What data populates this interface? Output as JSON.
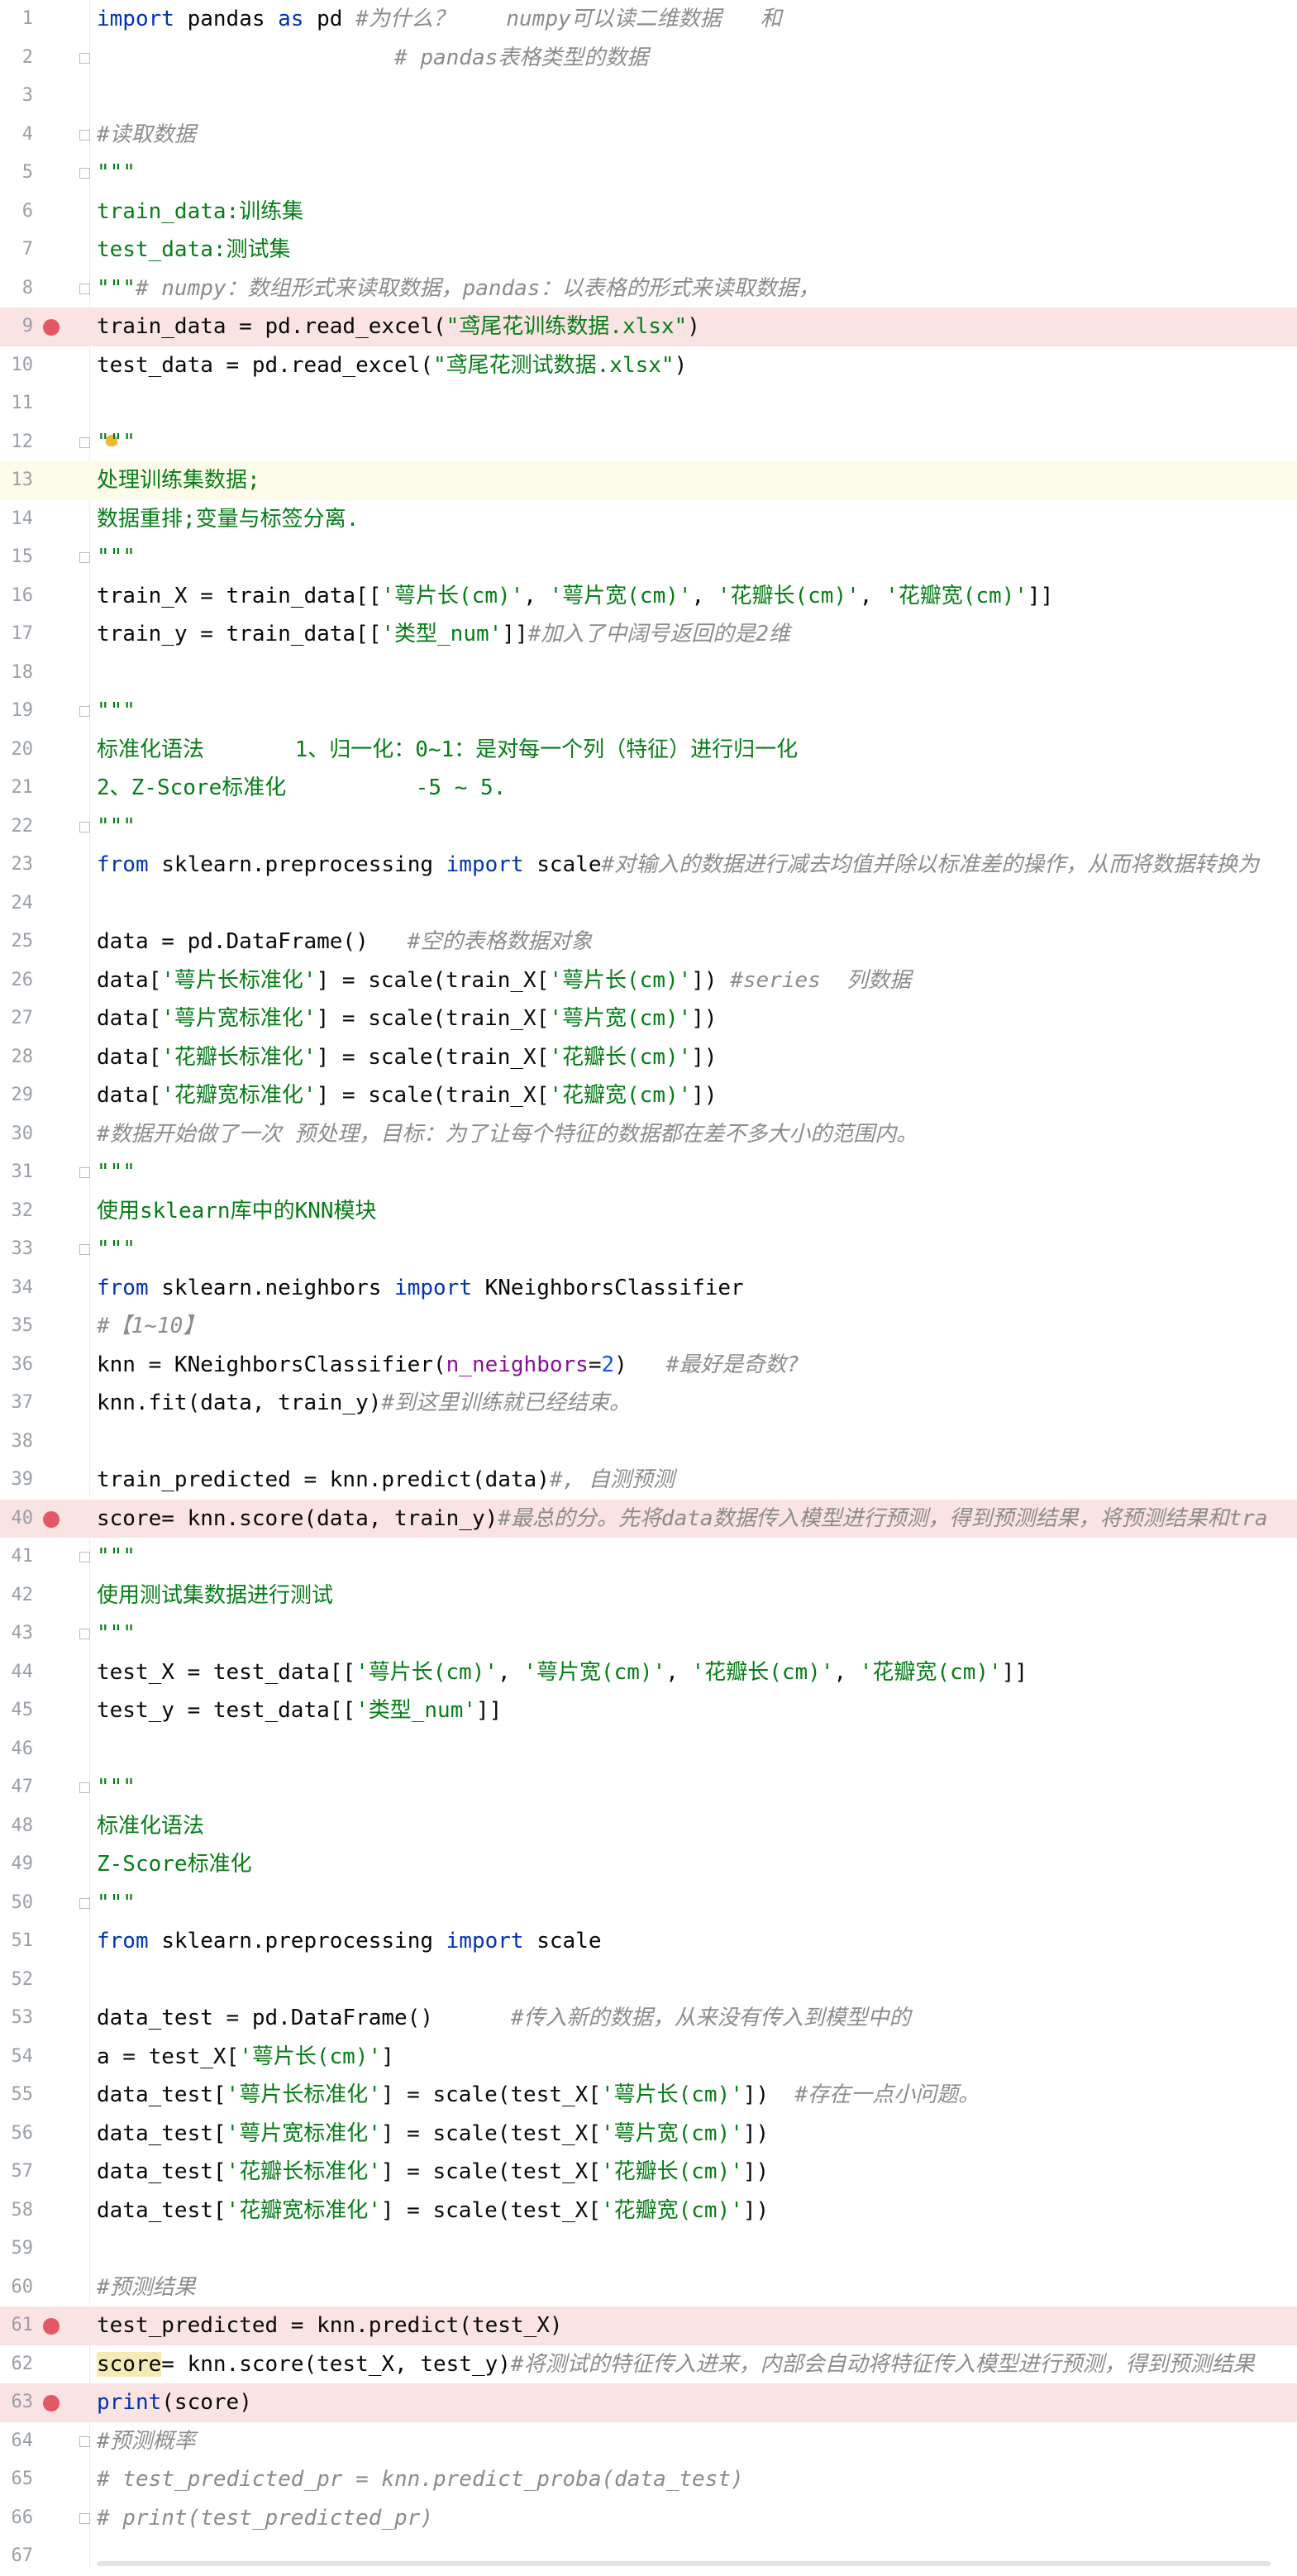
{
  "editor": {
    "lines": [
      {
        "n": "1",
        "marker": "",
        "tokens": [
          {
            "t": "kw",
            "v": "import"
          },
          {
            "t": "",
            "v": " pandas "
          },
          {
            "t": "kw",
            "v": "as"
          },
          {
            "t": "",
            "v": " pd "
          },
          {
            "t": "cm",
            "v": "#为什么？    numpy可以读二维数据   和"
          }
        ]
      },
      {
        "n": "2",
        "marker": "",
        "tokens": [
          {
            "t": "",
            "v": "                       "
          },
          {
            "t": "cm",
            "v": "# pandas表格类型的数据"
          }
        ]
      },
      {
        "n": "3",
        "marker": "",
        "tokens": []
      },
      {
        "n": "4",
        "marker": "",
        "tokens": [
          {
            "t": "cm",
            "v": "#读取数据"
          }
        ]
      },
      {
        "n": "5",
        "marker": "",
        "tokens": [
          {
            "t": "str",
            "v": "\"\"\""
          }
        ]
      },
      {
        "n": "6",
        "marker": "",
        "tokens": [
          {
            "t": "str",
            "v": "train_data:训练集"
          }
        ]
      },
      {
        "n": "7",
        "marker": "",
        "tokens": [
          {
            "t": "str",
            "v": "test_data:测试集"
          }
        ]
      },
      {
        "n": "8",
        "marker": "",
        "tokens": [
          {
            "t": "str",
            "v": "\"\"\""
          },
          {
            "t": "cm",
            "v": "# numpy：数组形式来读取数据，pandas：以表格的形式来读取数据，"
          }
        ]
      },
      {
        "n": "9",
        "marker": "bp",
        "tokens": [
          {
            "t": "",
            "v": "train_data = pd.read_excel("
          },
          {
            "t": "str",
            "v": "\"鸢尾花训练数据.xlsx\""
          },
          {
            "t": "",
            "v": ")"
          }
        ]
      },
      {
        "n": "10",
        "marker": "",
        "tokens": [
          {
            "t": "",
            "v": "test_data = pd.read_excel("
          },
          {
            "t": "str",
            "v": "\"鸢尾花测试数据.xlsx\""
          },
          {
            "t": "",
            "v": ")"
          }
        ]
      },
      {
        "n": "11",
        "marker": "",
        "tokens": []
      },
      {
        "n": "12",
        "marker": "bulb",
        "tokens": [
          {
            "t": "str",
            "v": "\"\"\""
          }
        ]
      },
      {
        "n": "13",
        "marker": "cur",
        "tokens": [
          {
            "t": "str",
            "v": "处理训练集数据;"
          }
        ]
      },
      {
        "n": "14",
        "marker": "",
        "tokens": [
          {
            "t": "str",
            "v": "数据重排;变量与标签分离."
          }
        ]
      },
      {
        "n": "15",
        "marker": "",
        "tokens": [
          {
            "t": "str",
            "v": "\"\"\""
          }
        ]
      },
      {
        "n": "16",
        "marker": "",
        "tokens": [
          {
            "t": "",
            "v": "train_X = train_data[["
          },
          {
            "t": "str",
            "v": "'萼片长(cm)'"
          },
          {
            "t": "",
            "v": ", "
          },
          {
            "t": "str",
            "v": "'萼片宽(cm)'"
          },
          {
            "t": "",
            "v": ", "
          },
          {
            "t": "str",
            "v": "'花瓣长(cm)'"
          },
          {
            "t": "",
            "v": ", "
          },
          {
            "t": "str",
            "v": "'花瓣宽(cm)'"
          },
          {
            "t": "",
            "v": "]]"
          }
        ]
      },
      {
        "n": "17",
        "marker": "",
        "tokens": [
          {
            "t": "",
            "v": "train_y = train_data[["
          },
          {
            "t": "str",
            "v": "'类型_num'"
          },
          {
            "t": "",
            "v": "]]"
          },
          {
            "t": "cm",
            "v": "#加入了中阔号返回的是2维"
          }
        ]
      },
      {
        "n": "18",
        "marker": "",
        "tokens": []
      },
      {
        "n": "19",
        "marker": "",
        "tokens": [
          {
            "t": "str",
            "v": "\"\"\""
          }
        ]
      },
      {
        "n": "20",
        "marker": "",
        "tokens": [
          {
            "t": "str",
            "v": "标准化语法       1、归一化：0~1：是对每一个列（特征）进行归一化"
          }
        ]
      },
      {
        "n": "21",
        "marker": "",
        "tokens": [
          {
            "t": "str",
            "v": "2、Z-Score标准化          -5 ~ 5."
          }
        ]
      },
      {
        "n": "22",
        "marker": "",
        "tokens": [
          {
            "t": "str",
            "v": "\"\"\""
          }
        ]
      },
      {
        "n": "23",
        "marker": "",
        "tokens": [
          {
            "t": "kw",
            "v": "from"
          },
          {
            "t": "",
            "v": " sklearn.preprocessing "
          },
          {
            "t": "kw",
            "v": "import"
          },
          {
            "t": "",
            "v": " scale"
          },
          {
            "t": "cm",
            "v": "#对输入的数据进行减去均值并除以标准差的操作，从而将数据转换为"
          }
        ]
      },
      {
        "n": "24",
        "marker": "",
        "tokens": []
      },
      {
        "n": "25",
        "marker": "",
        "tokens": [
          {
            "t": "",
            "v": "data = pd.DataFrame()   "
          },
          {
            "t": "cm",
            "v": "#空的表格数据对象"
          }
        ]
      },
      {
        "n": "26",
        "marker": "",
        "tokens": [
          {
            "t": "",
            "v": "data["
          },
          {
            "t": "str",
            "v": "'萼片长标准化'"
          },
          {
            "t": "",
            "v": "] = scale(train_X["
          },
          {
            "t": "str",
            "v": "'萼片长(cm)'"
          },
          {
            "t": "",
            "v": "]) "
          },
          {
            "t": "cm",
            "v": "#series  列数据"
          }
        ]
      },
      {
        "n": "27",
        "marker": "",
        "tokens": [
          {
            "t": "",
            "v": "data["
          },
          {
            "t": "str",
            "v": "'萼片宽标准化'"
          },
          {
            "t": "",
            "v": "] = scale(train_X["
          },
          {
            "t": "str",
            "v": "'萼片宽(cm)'"
          },
          {
            "t": "",
            "v": "])"
          }
        ]
      },
      {
        "n": "28",
        "marker": "",
        "tokens": [
          {
            "t": "",
            "v": "data["
          },
          {
            "t": "str",
            "v": "'花瓣长标准化'"
          },
          {
            "t": "",
            "v": "] = scale(train_X["
          },
          {
            "t": "str",
            "v": "'花瓣长(cm)'"
          },
          {
            "t": "",
            "v": "])"
          }
        ]
      },
      {
        "n": "29",
        "marker": "",
        "tokens": [
          {
            "t": "",
            "v": "data["
          },
          {
            "t": "str",
            "v": "'花瓣宽标准化'"
          },
          {
            "t": "",
            "v": "] = scale(train_X["
          },
          {
            "t": "str",
            "v": "'花瓣宽(cm)'"
          },
          {
            "t": "",
            "v": "])"
          }
        ]
      },
      {
        "n": "30",
        "marker": "",
        "tokens": [
          {
            "t": "cm",
            "v": "#数据开始做了一次 预处理，目标：为了让每个特征的数据都在差不多大小的范围内。"
          }
        ]
      },
      {
        "n": "31",
        "marker": "",
        "tokens": [
          {
            "t": "str",
            "v": "\"\"\""
          }
        ]
      },
      {
        "n": "32",
        "marker": "",
        "tokens": [
          {
            "t": "str",
            "v": "使用sklearn库中的KNN模块"
          }
        ]
      },
      {
        "n": "33",
        "marker": "",
        "tokens": [
          {
            "t": "str",
            "v": "\"\"\""
          }
        ]
      },
      {
        "n": "34",
        "marker": "",
        "tokens": [
          {
            "t": "kw",
            "v": "from"
          },
          {
            "t": "",
            "v": " sklearn.neighbors "
          },
          {
            "t": "kw",
            "v": "import"
          },
          {
            "t": "",
            "v": " KNeighborsClassifier"
          }
        ]
      },
      {
        "n": "35",
        "marker": "",
        "tokens": [
          {
            "t": "cm",
            "v": "#【1~10】"
          }
        ]
      },
      {
        "n": "36",
        "marker": "",
        "tokens": [
          {
            "t": "",
            "v": "knn = KNeighborsClassifier("
          },
          {
            "t": "param",
            "v": "n_neighbors"
          },
          {
            "t": "",
            "v": "="
          },
          {
            "t": "num",
            "v": "2"
          },
          {
            "t": "",
            "v": ")   "
          },
          {
            "t": "cm",
            "v": "#最好是奇数?"
          }
        ]
      },
      {
        "n": "37",
        "marker": "",
        "tokens": [
          {
            "t": "",
            "v": "knn.fit(data, train_y)"
          },
          {
            "t": "cm",
            "v": "#到这里训练就已经结束。"
          }
        ]
      },
      {
        "n": "38",
        "marker": "",
        "tokens": []
      },
      {
        "n": "39",
        "marker": "",
        "tokens": [
          {
            "t": "",
            "v": "train_predicted = knn.predict(data)"
          },
          {
            "t": "cm",
            "v": "#, 自测预测"
          }
        ]
      },
      {
        "n": "40",
        "marker": "bp",
        "tokens": [
          {
            "t": "",
            "v": "score= knn.score(data, train_y)"
          },
          {
            "t": "cm",
            "v": "#最总的分。先将data数据传入模型进行预测，得到预测结果，将预测结果和tra"
          }
        ]
      },
      {
        "n": "41",
        "marker": "",
        "tokens": [
          {
            "t": "str",
            "v": "\"\"\""
          }
        ]
      },
      {
        "n": "42",
        "marker": "",
        "tokens": [
          {
            "t": "str",
            "v": "使用测试集数据进行测试"
          }
        ]
      },
      {
        "n": "43",
        "marker": "",
        "tokens": [
          {
            "t": "str",
            "v": "\"\"\""
          }
        ]
      },
      {
        "n": "44",
        "marker": "",
        "tokens": [
          {
            "t": "",
            "v": "test_X = test_data[["
          },
          {
            "t": "str",
            "v": "'萼片长(cm)'"
          },
          {
            "t": "",
            "v": ", "
          },
          {
            "t": "str",
            "v": "'萼片宽(cm)'"
          },
          {
            "t": "",
            "v": ", "
          },
          {
            "t": "str",
            "v": "'花瓣长(cm)'"
          },
          {
            "t": "",
            "v": ", "
          },
          {
            "t": "str",
            "v": "'花瓣宽(cm)'"
          },
          {
            "t": "",
            "v": "]]"
          }
        ]
      },
      {
        "n": "45",
        "marker": "",
        "tokens": [
          {
            "t": "",
            "v": "test_y = test_data[["
          },
          {
            "t": "str",
            "v": "'类型_num'"
          },
          {
            "t": "",
            "v": "]]"
          }
        ]
      },
      {
        "n": "46",
        "marker": "",
        "tokens": []
      },
      {
        "n": "47",
        "marker": "",
        "tokens": [
          {
            "t": "str",
            "v": "\"\"\""
          }
        ]
      },
      {
        "n": "48",
        "marker": "",
        "tokens": [
          {
            "t": "str",
            "v": "标准化语法"
          }
        ]
      },
      {
        "n": "49",
        "marker": "",
        "tokens": [
          {
            "t": "str",
            "v": "Z-Score标准化"
          }
        ]
      },
      {
        "n": "50",
        "marker": "",
        "tokens": [
          {
            "t": "str",
            "v": "\"\"\""
          }
        ]
      },
      {
        "n": "51",
        "marker": "",
        "tokens": [
          {
            "t": "kw",
            "v": "from"
          },
          {
            "t": "",
            "v": " sklearn.preprocessing "
          },
          {
            "t": "kw",
            "v": "import"
          },
          {
            "t": "",
            "v": " scale"
          }
        ]
      },
      {
        "n": "52",
        "marker": "",
        "tokens": []
      },
      {
        "n": "53",
        "marker": "",
        "tokens": [
          {
            "t": "",
            "v": "data_test = pd.DataFrame()      "
          },
          {
            "t": "cm",
            "v": "#传入新的数据，从来没有传入到模型中的"
          }
        ]
      },
      {
        "n": "54",
        "marker": "",
        "tokens": [
          {
            "t": "",
            "v": "a = test_X["
          },
          {
            "t": "str",
            "v": "'萼片长(cm)'"
          },
          {
            "t": "",
            "v": "]"
          }
        ]
      },
      {
        "n": "55",
        "marker": "",
        "tokens": [
          {
            "t": "",
            "v": "data_test["
          },
          {
            "t": "str",
            "v": "'萼片长标准化'"
          },
          {
            "t": "",
            "v": "] = scale(test_X["
          },
          {
            "t": "str",
            "v": "'萼片长(cm)'"
          },
          {
            "t": "",
            "v": "])  "
          },
          {
            "t": "cm",
            "v": "#存在一点小问题。"
          }
        ]
      },
      {
        "n": "56",
        "marker": "",
        "tokens": [
          {
            "t": "",
            "v": "data_test["
          },
          {
            "t": "str",
            "v": "'萼片宽标准化'"
          },
          {
            "t": "",
            "v": "] = scale(test_X["
          },
          {
            "t": "str",
            "v": "'萼片宽(cm)'"
          },
          {
            "t": "",
            "v": "])"
          }
        ]
      },
      {
        "n": "57",
        "marker": "",
        "tokens": [
          {
            "t": "",
            "v": "data_test["
          },
          {
            "t": "str",
            "v": "'花瓣长标准化'"
          },
          {
            "t": "",
            "v": "] = scale(test_X["
          },
          {
            "t": "str",
            "v": "'花瓣长(cm)'"
          },
          {
            "t": "",
            "v": "])"
          }
        ]
      },
      {
        "n": "58",
        "marker": "",
        "tokens": [
          {
            "t": "",
            "v": "data_test["
          },
          {
            "t": "str",
            "v": "'花瓣宽标准化'"
          },
          {
            "t": "",
            "v": "] = scale(test_X["
          },
          {
            "t": "str",
            "v": "'花瓣宽(cm)'"
          },
          {
            "t": "",
            "v": "])"
          }
        ]
      },
      {
        "n": "59",
        "marker": "",
        "tokens": []
      },
      {
        "n": "60",
        "marker": "",
        "tokens": [
          {
            "t": "cm",
            "v": "#预测结果"
          }
        ]
      },
      {
        "n": "61",
        "marker": "bp",
        "tokens": [
          {
            "t": "",
            "v": "test_predicted = knn.predict(test_X)"
          }
        ]
      },
      {
        "n": "62",
        "marker": "",
        "tokens": [
          {
            "t": "warn",
            "v": "score"
          },
          {
            "t": "",
            "v": "= knn.score(test_X, test_y)"
          },
          {
            "t": "cm",
            "v": "#将测试的特征传入进来，内部会自动将特征传入模型进行预测，得到预测结果"
          }
        ]
      },
      {
        "n": "63",
        "marker": "bp",
        "tokens": [
          {
            "t": "kw",
            "v": "print"
          },
          {
            "t": "",
            "v": "(score)"
          }
        ]
      },
      {
        "n": "64",
        "marker": "",
        "tokens": [
          {
            "t": "cm",
            "v": "#预测概率"
          }
        ]
      },
      {
        "n": "65",
        "marker": "",
        "tokens": [
          {
            "t": "cm",
            "v": "# test_predicted_pr = knn.predict_proba(data_test)"
          }
        ]
      },
      {
        "n": "66",
        "marker": "",
        "tokens": [
          {
            "t": "cm",
            "v": "# print(test_predicted_pr)"
          }
        ]
      },
      {
        "n": "67",
        "marker": "",
        "tokens": []
      }
    ],
    "fold_lines": [
      "2",
      "4",
      "5",
      "8",
      "12",
      "15",
      "19",
      "22",
      "31",
      "33",
      "41",
      "43",
      "47",
      "50",
      "64",
      "66"
    ],
    "colors": {
      "keyword": "#0033b3",
      "string": "#067d17",
      "comment": "#8c8c8c",
      "parameter": "#871094",
      "number": "#1750eb",
      "breakpoint": "#e55765",
      "breakpoint_line": "#fae3e3",
      "current_line": "#fdfbe9"
    }
  }
}
